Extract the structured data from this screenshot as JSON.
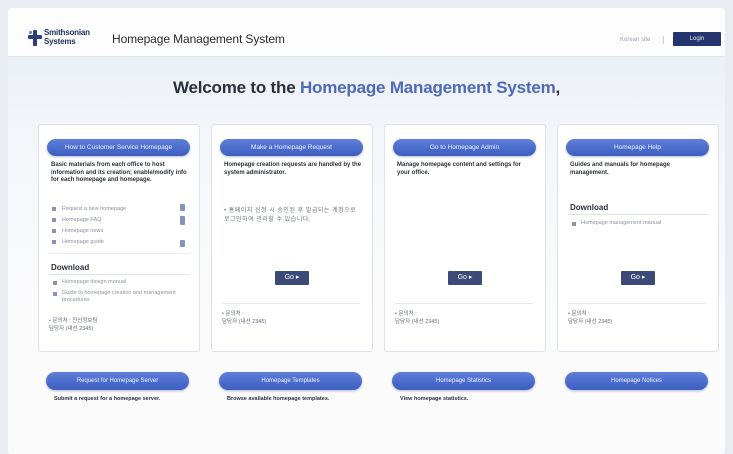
{
  "header": {
    "logo_line1": "Smithsonian",
    "logo_line2": "Systems",
    "app_title": "Homepage Management System",
    "link": "Korean site",
    "button": "Login"
  },
  "welcome": {
    "prefix": "Welcome to the ",
    "highlight": "Homepage Management System",
    "suffix": ","
  },
  "cards": [
    {
      "pill": "How to Customer Service Homepage",
      "desc": "Basic materials from each office to host information and its creation; enable/modify info for each homepage and homepage.",
      "list": [
        "Request a new homepage",
        "Homepage FAQ",
        "Homepage news",
        "Homepage guide"
      ],
      "download_title": "Download",
      "downloads": [
        "Homepage design manual",
        "Guide to homepage creation and management procedures"
      ],
      "contact_line1": "• 문의처 : 전산정보팀",
      "contact_line2": "담당자 (내선 2345)"
    },
    {
      "pill": "Make a Homepage Request",
      "desc": "Homepage creation requests are handled by the system administrator.",
      "korean": "• 홈페이지 신청 시 승인된 후 발급되는 계정으로 로그인하여 관리할 수 있습니다.",
      "go": "Go ▸",
      "contact_line1": "• 문의처 :",
      "contact_line2": "담당자 (내선 2345)"
    },
    {
      "pill": "Go to Homepage Admin",
      "desc": "Manage homepage content and settings for your office.",
      "go": "Go ▸",
      "contact_line1": "• 문의처 :",
      "contact_line2": "담당자 (내선 2345)"
    },
    {
      "pill": "Homepage Help",
      "desc": "Guides and manuals for homepage management.",
      "download_title": "Download",
      "downloads": [
        "Homepage management manual"
      ],
      "go": "Go ▸",
      "contact_line1": "• 문의처 :",
      "contact_line2": "담당자 (내선 2345)"
    }
  ],
  "bottom": [
    {
      "pill": "Request for Homepage Server",
      "desc": "Submit a request for a homepage server."
    },
    {
      "pill": "Homepage Templates",
      "desc": "Browse available homepage templates."
    },
    {
      "pill": "Homepage Statistics",
      "desc": "View homepage statistics."
    },
    {
      "pill": "Homepage Notices",
      "desc": ""
    }
  ]
}
